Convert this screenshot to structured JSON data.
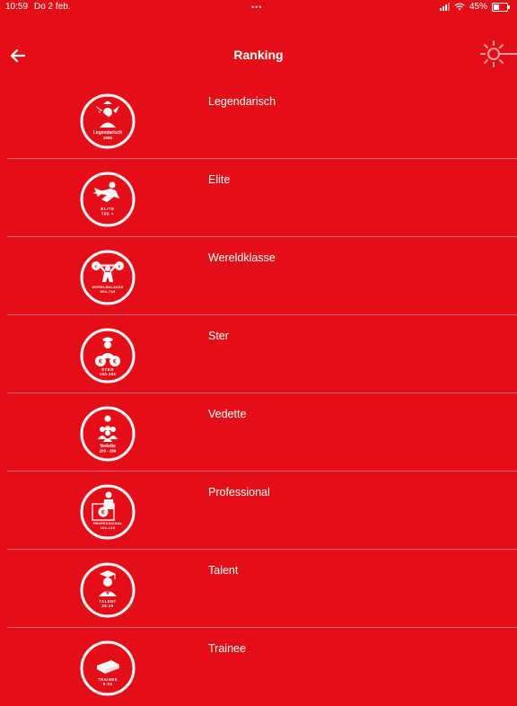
{
  "status_bar": {
    "time": "10:59",
    "date": "Do 2 feb.",
    "battery": "45%",
    "battery_level": 0.45,
    "dots": "•••"
  },
  "header": {
    "title": "Ranking"
  },
  "icons": {
    "back": "arrow-left-icon",
    "settings": "sun-settings-icon",
    "wifi": "wifi-icon",
    "battery": "battery-icon",
    "signal": "signal-icon"
  },
  "colors": {
    "background": "#e30e18",
    "foreground": "#ffffff",
    "divider": "#f06a70"
  },
  "ranks": [
    {
      "label": "Legendarisch",
      "badge_lines": [
        "Legendarisch",
        "1000"
      ]
    },
    {
      "label": "Elite",
      "badge_lines": [
        "ELITE",
        "750 >"
      ]
    },
    {
      "label": "Wereldklasse",
      "badge_lines": [
        "WERELDKLASSE",
        "500-749"
      ]
    },
    {
      "label": "Ster",
      "badge_lines": [
        "STER",
        "150-399"
      ]
    },
    {
      "label": "Vedette",
      "badge_lines": [
        "Vedette",
        "200 - 299"
      ]
    },
    {
      "label": "Professional",
      "badge_lines": [
        "PROFESSIONAL",
        "100-149"
      ]
    },
    {
      "label": "Talent",
      "badge_lines": [
        "TALENT",
        "25-49"
      ]
    },
    {
      "label": "Trainee",
      "badge_lines": [
        "TRAINEE",
        "0-24"
      ]
    }
  ]
}
